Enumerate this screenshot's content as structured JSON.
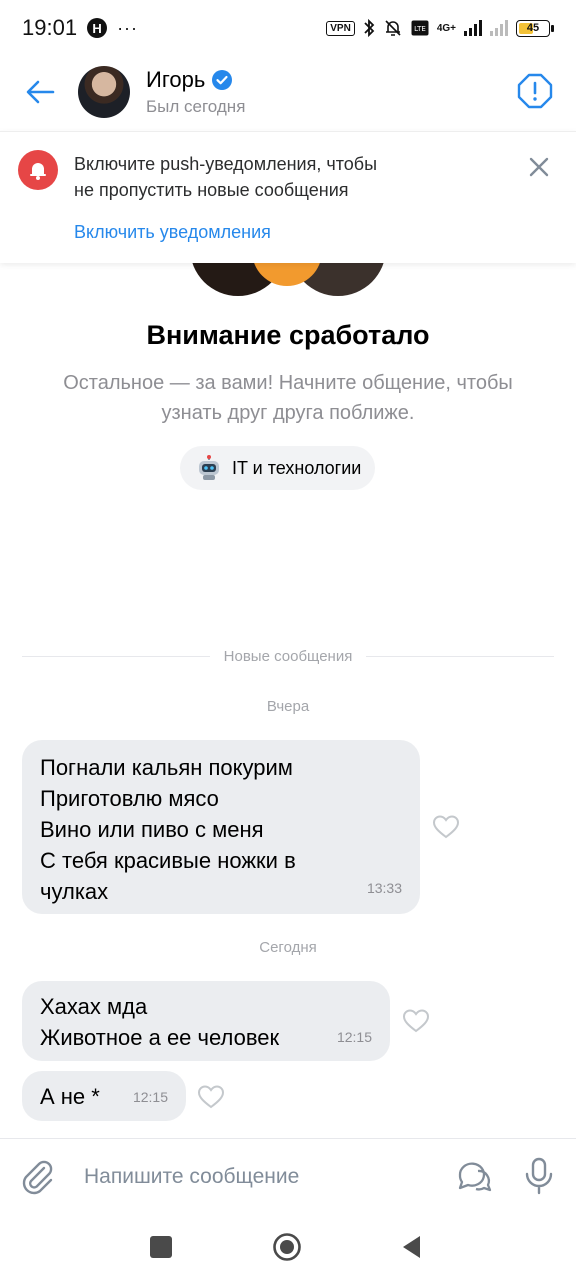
{
  "status_bar": {
    "time": "19:01",
    "h_badge": "H",
    "dots": "···",
    "vpn": "VPN",
    "network": "4G+",
    "battery": "45"
  },
  "header": {
    "name": "Игорь",
    "status": "Был сегодня"
  },
  "push_banner": {
    "line1": "Включите push-уведомления, чтобы",
    "line2": "не пропустить новые сообщения",
    "action": "Включить уведомления"
  },
  "match": {
    "title": "Внимание сработало",
    "subtitle": "Остальное — за вами! Начните общение, чтобы узнать друг друга поближе.",
    "interest": "IT и технологии"
  },
  "divider_new": "Новые сообщения",
  "days": {
    "yesterday": "Вчера",
    "today": "Сегодня"
  },
  "messages": [
    {
      "lines": [
        "Погнали кальян покурим",
        "Приготовлю мясо",
        "Вино или пиво с меня",
        "С тебя красивые ножки в",
        "чулках"
      ],
      "time": "13:33"
    },
    {
      "lines": [
        "Хахах мда",
        "Животное а ее человек"
      ],
      "time": "12:15"
    },
    {
      "lines": [
        "А не *"
      ],
      "time": "12:15"
    }
  ],
  "composer": {
    "placeholder": "Напишите сообщение"
  },
  "colors": {
    "accent": "#2688eb",
    "bubble": "#ebedf0",
    "bell": "#e64646"
  }
}
